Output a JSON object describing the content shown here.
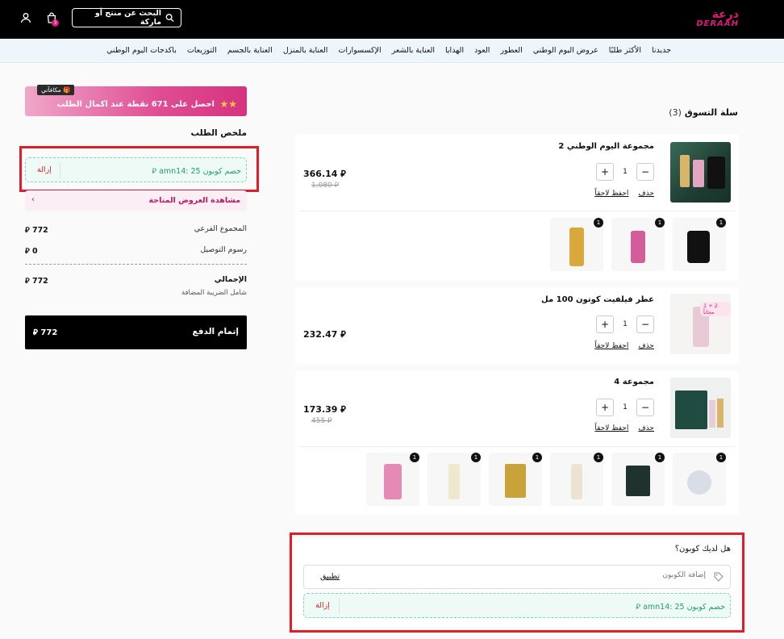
{
  "header": {
    "logo_ar": "درعة",
    "logo_en": "DERAAH",
    "search_placeholder": "البحث عن منتج أو ماركة",
    "cart_count": "3"
  },
  "nav": [
    "جديدنا",
    "الأكثر طلبًا",
    "عروض اليوم الوطني",
    "العطور",
    "العود",
    "الهدايا",
    "العناية بالشعر",
    "الإكسسوارات",
    "العناية بالمنزل",
    "العناية بالجسم",
    "التوزيعات",
    "باكدجات اليوم الوطني"
  ],
  "rewards": {
    "text": "احصل على 671 نقطة عند اكمال الطلب",
    "tag": "مكافآتي"
  },
  "summary": {
    "title": "ملخص الطلب",
    "coupon_text": "خصم كوبون amn14: 25 ⃁",
    "remove": "إزالة",
    "offers": "مشاهدة العروض المتاحة",
    "subtotal_label": "المجموع الفرعي",
    "subtotal": "772 ⃁",
    "shipping_label": "رسوم التوصيل",
    "shipping": "0 ⃁",
    "total_label": "الإجمالي",
    "total": "772 ⃁",
    "vat_note": "شامل الضريبة المضافة",
    "checkout_label": "إتمام الدفع",
    "checkout_total": "772 ⃁"
  },
  "cart": {
    "title": "سلة التسوق",
    "count": "(3)",
    "delete_label": "حذف",
    "save_label": "احفظ لاحقاً",
    "items": [
      {
        "name": "مجموعة اليوم الوطني 2",
        "qty": "1",
        "price": "366.14 ⃁",
        "old": "1,080 ⃁",
        "bundle_badge": "1"
      },
      {
        "name": "عطر فيلفيت كوتون 100 مل",
        "qty": "1",
        "price": "232.47 ⃁",
        "promo": "1 + 2 مجاناً"
      },
      {
        "name": "مجموعة 4",
        "qty": "1",
        "price": "173.39 ⃁",
        "old": "455 ⃁",
        "bundle_badge": "1"
      }
    ]
  },
  "coupon": {
    "question": "هل لديك كوبون؟",
    "placeholder": "إضافة الكوبون",
    "apply": "تطبيق",
    "applied_text": "خصم كوبون amn14: 25 ⃁",
    "remove": "إزالة"
  }
}
